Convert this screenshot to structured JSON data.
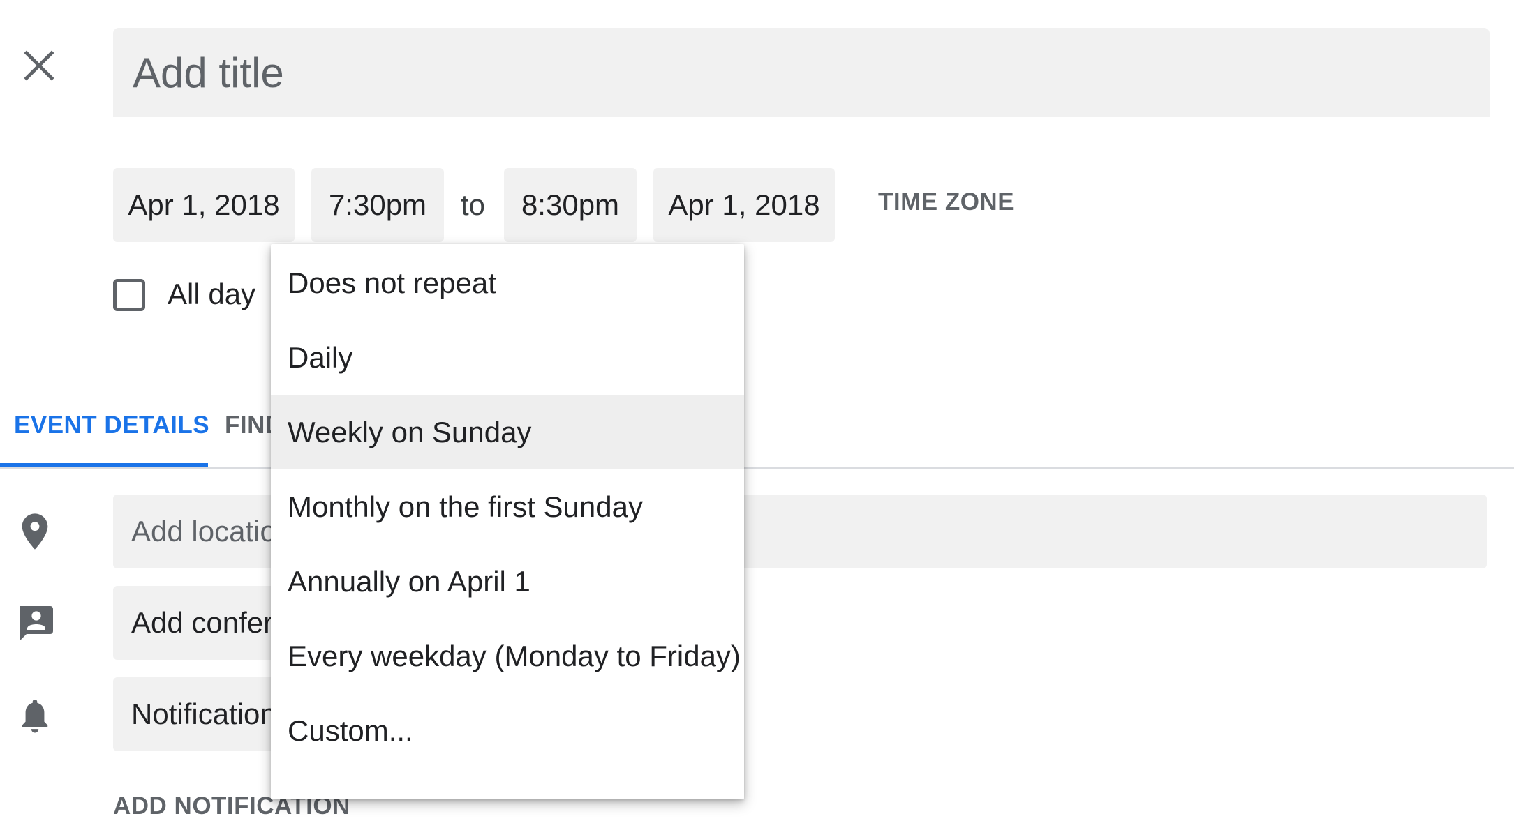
{
  "header": {
    "close_icon": "close-icon",
    "title_placeholder": "Add title"
  },
  "datetime": {
    "start_date": "Apr 1, 2018",
    "start_time": "7:30pm",
    "to_label": "to",
    "end_time": "8:30pm",
    "end_date": "Apr 1, 2018",
    "time_zone_label": "TIME ZONE"
  },
  "all_day": {
    "label": "All day",
    "checked": false
  },
  "tabs": [
    {
      "label": "EVENT DETAILS",
      "active": true
    },
    {
      "label": "FIND",
      "active": false
    }
  ],
  "fields": {
    "location_placeholder": "Add locatio",
    "location_icon": "location-pin-icon",
    "conference_label": "Add confer",
    "conference_icon": "conference-icon",
    "notification_label": "Notification",
    "notification_icon": "bell-icon",
    "add_notification_label": "ADD NOTIFICATION"
  },
  "repeat_menu": {
    "selected_index": 2,
    "items": [
      {
        "label": "Does not repeat"
      },
      {
        "label": "Daily"
      },
      {
        "label": "Weekly on Sunday"
      },
      {
        "label": "Monthly on the first Sunday"
      },
      {
        "label": "Annually on April 1"
      },
      {
        "label": "Every weekday (Monday to Friday)"
      },
      {
        "label": "Custom..."
      }
    ]
  },
  "colors": {
    "accent": "#1a73e8",
    "field_bg": "#f1f1f1",
    "muted_text": "#5f6368",
    "selected_item_bg": "#eeeeee"
  }
}
